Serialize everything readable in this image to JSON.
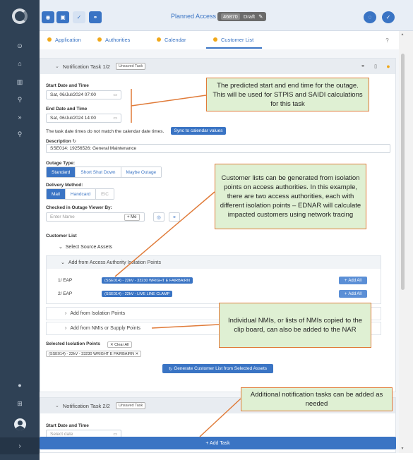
{
  "topbar": {
    "title": "Planned Access",
    "nar_number": "46870",
    "status": "Draft"
  },
  "tabs": [
    {
      "label": "Application"
    },
    {
      "label": "Authorities"
    },
    {
      "label": "Calendar"
    },
    {
      "label": "Customer List"
    }
  ],
  "task1": {
    "title": "Notification Task 1/2",
    "unsaved": "Unsaved Task",
    "start_label": "Start Date and Time",
    "start_value": "Sat, 06/Jul/2024 07:00",
    "end_label": "End Date and Time",
    "end_value": "Sat, 06/Jul/2024 14:00",
    "mismatch_text": "The task date times do not match the calendar date times.",
    "sync_button": "Sync to calendar values",
    "description_label": "Description",
    "description_value": "SSE014: 19256526: General Maintenance",
    "outage_label": "Outage Type:",
    "outage_options": [
      "Standard",
      "Short Shut Down",
      "Maybe Outage"
    ],
    "delivery_label": "Delivery Method:",
    "delivery_options": [
      "Mail",
      "Handcard",
      "EIC"
    ],
    "checked_label": "Checked in Outage Viewer By:",
    "checked_placeholder": "Enter Name",
    "me_button": "+ Me",
    "customer_list_label": "Customer List",
    "select_source": "Select Source Assets",
    "add_from_access": "Add from Access Authority Isolation Points",
    "isolation_rows": [
      {
        "label": "1/ EAP",
        "tag": "(SSE014) - 22kV - 33230 WRIGHT E FAIRBAIRN",
        "button": "Add All"
      },
      {
        "label": "2/ EAP",
        "tag": "(SSE014) - 22kV - LIVE LINE CLAMP",
        "button": "Add All"
      }
    ],
    "add_from_isolation": "Add from Isolation Points",
    "add_from_nmis": "Add from NMIs or Supply Points",
    "selected_label": "Selected Isolation Points",
    "clear_all": "Clear All",
    "selected_chip": "(SSE014) - 22kV - 33230 WRIGHT E FAIRBAIRN",
    "generate_button": "Generate Customer List from Selected Assets"
  },
  "task2": {
    "title": "Notification Task 2/2",
    "unsaved": "Unsaved Task",
    "start_label": "Start Date and Time",
    "start_placeholder": "Select date"
  },
  "add_task_button": "+ Add Task",
  "notes": [
    "The predicted start and end time for the outage. This will be used for STPIS and SAIDI calculations for this task",
    "Customer lists can be generated from isolation points on access authorities. In this example, there are two access authorities, each with different isolation points  – EDNAR will calculate impacted customers using network tracing",
    "Individual NMIs, or lists of NMIs copied to the clip board, can also be added to the NAR",
    "Additional notification tasks can be added as needed"
  ],
  "colors": {
    "primary": "#3a74c4",
    "sidebar": "#2f4155",
    "note_bg": "#dff0d3",
    "note_border": "#e07b39",
    "tab_dot": "#f0a81a"
  }
}
